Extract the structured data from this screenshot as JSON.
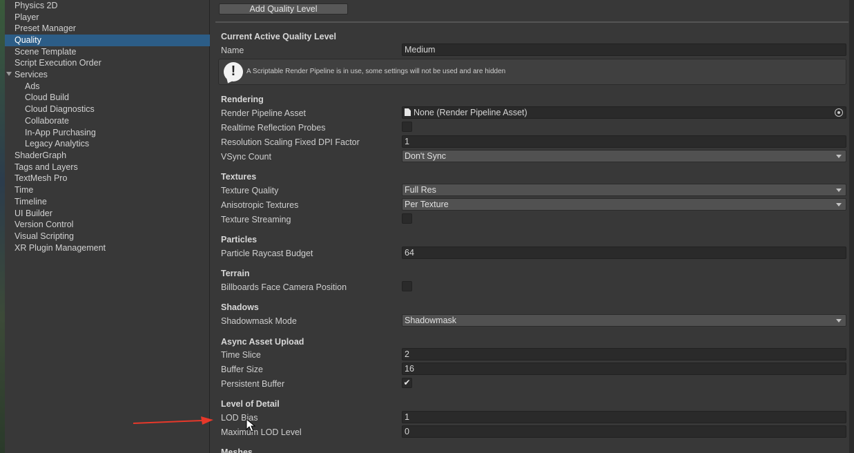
{
  "sidebar": {
    "items": [
      {
        "label": "Physics 2D"
      },
      {
        "label": "Player"
      },
      {
        "label": "Preset Manager"
      },
      {
        "label": "Quality",
        "selected": true
      },
      {
        "label": "Scene Template"
      },
      {
        "label": "Script Execution Order"
      },
      {
        "label": "Services",
        "expanded": true
      },
      {
        "label": "Ads",
        "child": true
      },
      {
        "label": "Cloud Build",
        "child": true
      },
      {
        "label": "Cloud Diagnostics",
        "child": true
      },
      {
        "label": "Collaborate",
        "child": true
      },
      {
        "label": "In-App Purchasing",
        "child": true
      },
      {
        "label": "Legacy Analytics",
        "child": true
      },
      {
        "label": "ShaderGraph"
      },
      {
        "label": "Tags and Layers"
      },
      {
        "label": "TextMesh Pro"
      },
      {
        "label": "Time"
      },
      {
        "label": "Timeline"
      },
      {
        "label": "UI Builder"
      },
      {
        "label": "Version Control"
      },
      {
        "label": "Visual Scripting"
      },
      {
        "label": "XR Plugin Management"
      }
    ]
  },
  "toolbar": {
    "add_quality_level": "Add Quality Level"
  },
  "current": {
    "header": "Current Active Quality Level",
    "name_label": "Name",
    "name_value": "Medium",
    "help_icon": "exclamation-icon",
    "help_text": "A Scriptable Render Pipeline is in use, some settings will not be used and are hidden"
  },
  "rendering": {
    "header": "Rendering",
    "rpa_label": "Render Pipeline Asset",
    "rpa_value": "None (Render Pipeline Asset)",
    "rrp_label": "Realtime Reflection Probes",
    "rrp_checked": false,
    "dpi_label": "Resolution Scaling Fixed DPI Factor",
    "dpi_value": "1",
    "vsync_label": "VSync Count",
    "vsync_value": "Don't Sync"
  },
  "textures": {
    "header": "Textures",
    "quality_label": "Texture Quality",
    "quality_value": "Full Res",
    "aniso_label": "Anisotropic Textures",
    "aniso_value": "Per Texture",
    "streaming_label": "Texture Streaming",
    "streaming_checked": false
  },
  "particles": {
    "header": "Particles",
    "raycast_label": "Particle Raycast Budget",
    "raycast_value": "64"
  },
  "terrain": {
    "header": "Terrain",
    "billboards_label": "Billboards Face Camera Position",
    "billboards_checked": false
  },
  "shadows": {
    "header": "Shadows",
    "mask_label": "Shadowmask Mode",
    "mask_value": "Shadowmask"
  },
  "async": {
    "header": "Async Asset Upload",
    "time_slice_label": "Time Slice",
    "time_slice_value": "2",
    "buffer_label": "Buffer Size",
    "buffer_value": "16",
    "persistent_label": "Persistent Buffer",
    "persistent_checked": true,
    "check_glyph": "✔"
  },
  "lod": {
    "header": "Level of Detail",
    "bias_label": "LOD Bias",
    "bias_value": "1",
    "max_label": "Maximum LOD Level",
    "max_value": "0"
  },
  "meshes": {
    "header": "Meshes"
  },
  "colors": {
    "selection": "#2c5d87",
    "annotation_arrow": "#e8382a"
  }
}
